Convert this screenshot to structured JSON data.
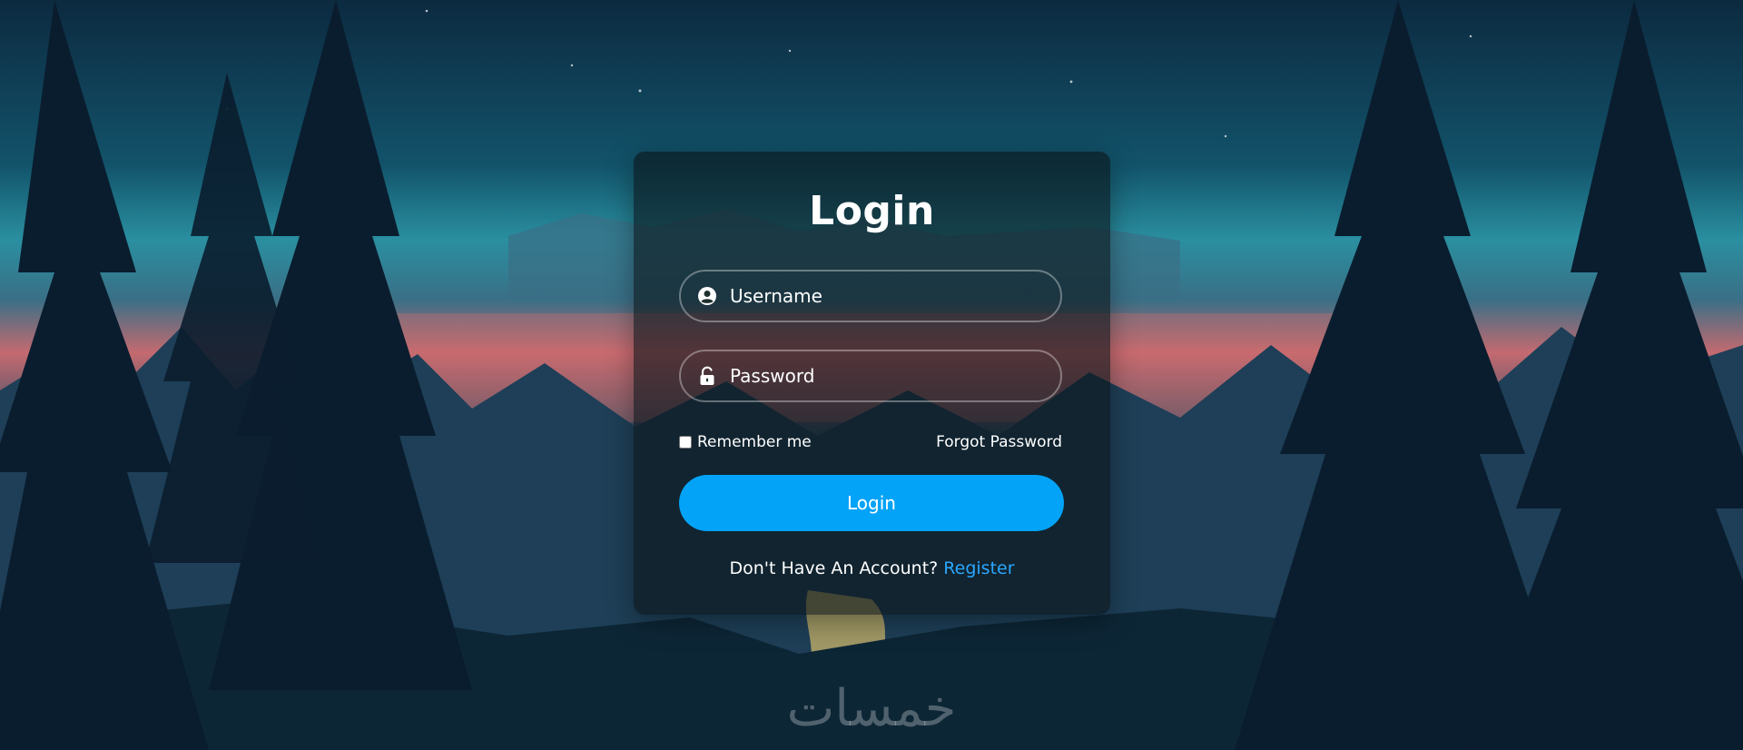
{
  "background": {
    "description_colors": {
      "sky_top": "#0c2a40",
      "glow": "#c46a70",
      "forest": "#0a1c2c"
    }
  },
  "login": {
    "title": "Login",
    "username": {
      "placeholder": "Username",
      "value": "",
      "icon": "user-circle-icon"
    },
    "password": {
      "placeholder": "Password",
      "value": "",
      "icon": "unlock-icon"
    },
    "remember_label": "Remember me",
    "forgot_label": "Forgot Password",
    "button_label": "Login",
    "no_account_text": "Don't Have An Account?",
    "register_label": "Register"
  },
  "watermark": {
    "text": "خمسات"
  },
  "colors": {
    "accent": "#03a3f7",
    "link": "#2aa7ff",
    "text": "#ffffff"
  }
}
